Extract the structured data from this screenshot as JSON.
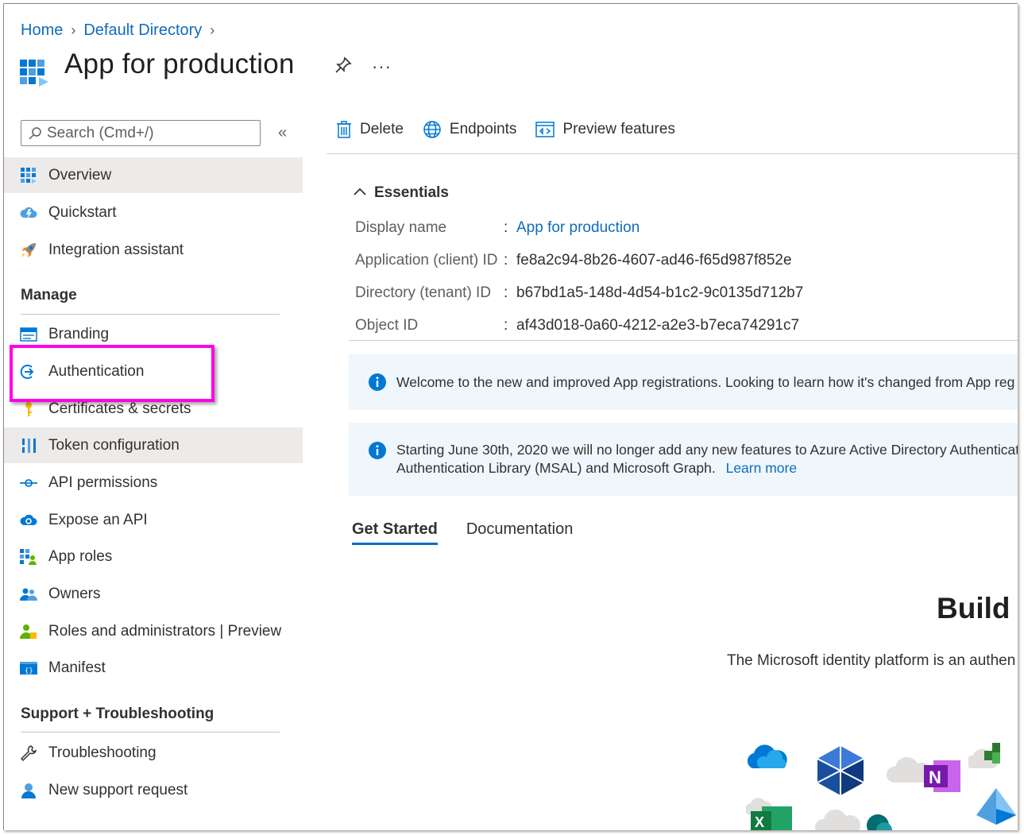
{
  "breadcrumb": {
    "home": "Home",
    "directory": "Default Directory"
  },
  "page_title": "App for production",
  "more_label": "···",
  "search": {
    "placeholder": "Search (Cmd+/)"
  },
  "collapse_label": "«",
  "nav": {
    "top_items": [
      {
        "label": "Overview",
        "icon": "grid-icon"
      },
      {
        "label": "Quickstart",
        "icon": "cloud-lightning-icon"
      },
      {
        "label": "Integration assistant",
        "icon": "rocket-icon"
      }
    ],
    "manage_header": "Manage",
    "manage_items": [
      {
        "label": "Branding",
        "icon": "branding-icon"
      },
      {
        "label": "Authentication",
        "icon": "authentication-icon"
      },
      {
        "label": "Certificates & secrets",
        "icon": "key-icon"
      },
      {
        "label": "Token configuration",
        "icon": "token-bars-icon"
      },
      {
        "label": "API permissions",
        "icon": "api-permissions-icon"
      },
      {
        "label": "Expose an API",
        "icon": "cloud-gear-icon"
      },
      {
        "label": "App roles",
        "icon": "app-roles-icon"
      },
      {
        "label": "Owners",
        "icon": "people-icon"
      },
      {
        "label": "Roles and administrators | Preview",
        "icon": "person-roles-icon"
      },
      {
        "label": "Manifest",
        "icon": "manifest-icon"
      }
    ],
    "support_header": "Support + Troubleshooting",
    "support_items": [
      {
        "label": "Troubleshooting",
        "icon": "wrench-icon"
      },
      {
        "label": "New support request",
        "icon": "person-support-icon"
      }
    ]
  },
  "toolbar": {
    "delete": "Delete",
    "endpoints": "Endpoints",
    "preview": "Preview features"
  },
  "essentials": {
    "header": "Essentials",
    "rows": [
      {
        "label": "Display name",
        "value": "App for production"
      },
      {
        "label": "Application (client) ID",
        "value": "fe8a2c94-8b26-4607-ad46-f65d987f852e"
      },
      {
        "label": "Directory (tenant) ID",
        "value": "b67bd1a5-148d-4d54-b1c2-9c0135d712b7"
      },
      {
        "label": "Object ID",
        "value": "af43d018-0a60-4212-a2e3-b7eca74291c7"
      }
    ]
  },
  "banners": {
    "welcome": "Welcome to the new and improved App registrations. Looking to learn how it's changed from App reg",
    "adal_line1": "Starting June 30th, 2020 we will no longer add any new features to Azure Active Directory Authenticat",
    "adal_line2": "Authentication Library (MSAL) and Microsoft Graph.",
    "learn_more": "Learn more"
  },
  "tabs": [
    "Get Started",
    "Documentation"
  ],
  "hero": {
    "title": "Build y",
    "subtitle": "The Microsoft identity platform is an authen"
  },
  "colors": {
    "accent": "#0f6cbd",
    "highlight": "#ff00e6",
    "banner_bg": "#eff6fc",
    "selected_bg": "#edebe9"
  }
}
